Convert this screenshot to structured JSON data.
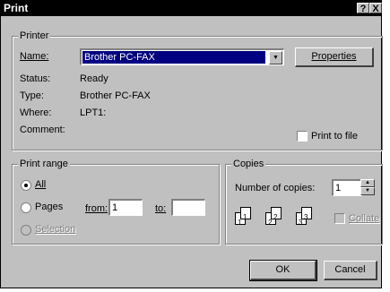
{
  "window": {
    "title": "Print",
    "help_label": "?",
    "close_label": "X"
  },
  "printer": {
    "group_title": "Printer",
    "name_label": "Name:",
    "name_value": "Brother PC-FAX",
    "properties_label": "Properties",
    "status_label": "Status:",
    "status_value": "Ready",
    "type_label": "Type:",
    "type_value": "Brother PC-FAX",
    "where_label": "Where:",
    "where_value": "LPT1:",
    "comment_label": "Comment:",
    "print_to_file_label": "Print to file"
  },
  "print_range": {
    "group_title": "Print range",
    "all_label": "All",
    "pages_label": "Pages",
    "from_label": "from:",
    "from_value": "1",
    "to_label": "to:",
    "to_value": "",
    "selection_label": "Selection"
  },
  "copies": {
    "group_title": "Copies",
    "number_label": "Number of copies:",
    "number_value": "1",
    "collate_label": "Collate",
    "pages": [
      "1",
      "1",
      "2",
      "2",
      "3",
      "3"
    ]
  },
  "buttons": {
    "ok": "OK",
    "cancel": "Cancel"
  }
}
